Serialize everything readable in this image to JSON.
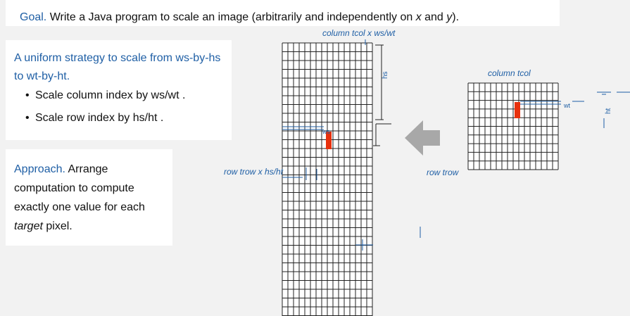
{
  "goal": {
    "prefix": "Goal.",
    "text": "Write a Java program to scale an image (arbitrarily and independently on ",
    "x": "x",
    "and": " and ",
    "y": "y",
    "suffix": ")."
  },
  "strategy": {
    "heading": "A uniform strategy to scale from ws-by-hs to wt-by-ht.",
    "bullets": [
      "Scale column index by ws/wt .",
      "Scale row index by hs/ht ."
    ]
  },
  "approach": {
    "prefix": "Approach.",
    "text": " Arrange computation to compute exactly one value for each ",
    "emph": "target",
    "suffix": " pixel."
  },
  "source": {
    "col_label": "column tcol x ws/wt",
    "row_label": "row trow x hs/ht",
    "dim_h": "hs",
    "dim_w": "ws"
  },
  "target": {
    "col_label": "column tcol",
    "row_label": "row trow",
    "dim_w": "wt",
    "dim_h": "ht"
  },
  "colors": {
    "accent": "#1f5fa5",
    "pixel": "#e8300c",
    "arrow": "#a8a8a8"
  }
}
